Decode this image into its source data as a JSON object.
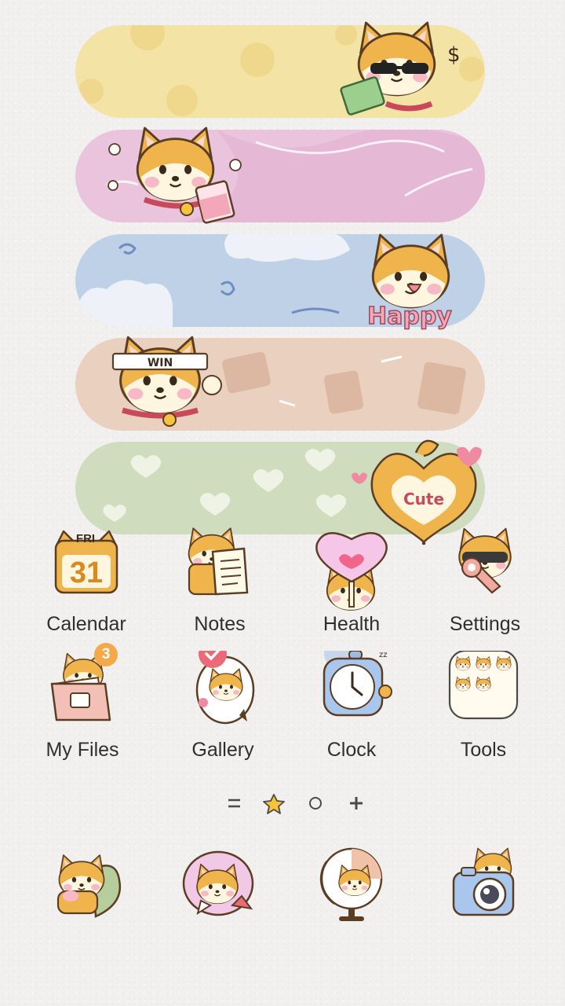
{
  "widgets": [
    {
      "name": "coins",
      "color": "#f3e3a4"
    },
    {
      "name": "drink",
      "color": "#e9c4dc"
    },
    {
      "name": "clouds",
      "color": "#bfd1e7"
    },
    {
      "name": "win",
      "color": "#ead0bf",
      "headband": "WIN"
    },
    {
      "name": "hearts",
      "color": "#cfdcbd"
    }
  ],
  "stickers": {
    "happy": "Happy",
    "cute": "Cute",
    "calendar_day": "FRI",
    "calendar_date": "31"
  },
  "apps": [
    {
      "label": "Calendar",
      "icon": "calendar-icon"
    },
    {
      "label": "Notes",
      "icon": "notes-icon"
    },
    {
      "label": "Health",
      "icon": "health-icon"
    },
    {
      "label": "Settings",
      "icon": "settings-icon"
    },
    {
      "label": "My Files",
      "icon": "folder-icon",
      "badge": "3"
    },
    {
      "label": "Gallery",
      "icon": "gallery-icon"
    },
    {
      "label": "Clock",
      "icon": "clock-icon"
    },
    {
      "label": "Tools",
      "icon": "tools-icon"
    }
  ],
  "pager": [
    "menu-icon",
    "star-icon",
    "circle-icon",
    "plus-icon"
  ],
  "dock": [
    "phone-icon",
    "messages-icon",
    "browser-icon",
    "camera-icon"
  ],
  "colors": {
    "accent": "#f0b44c",
    "badge": "#f6a94a",
    "label": "#2f2f2f"
  }
}
